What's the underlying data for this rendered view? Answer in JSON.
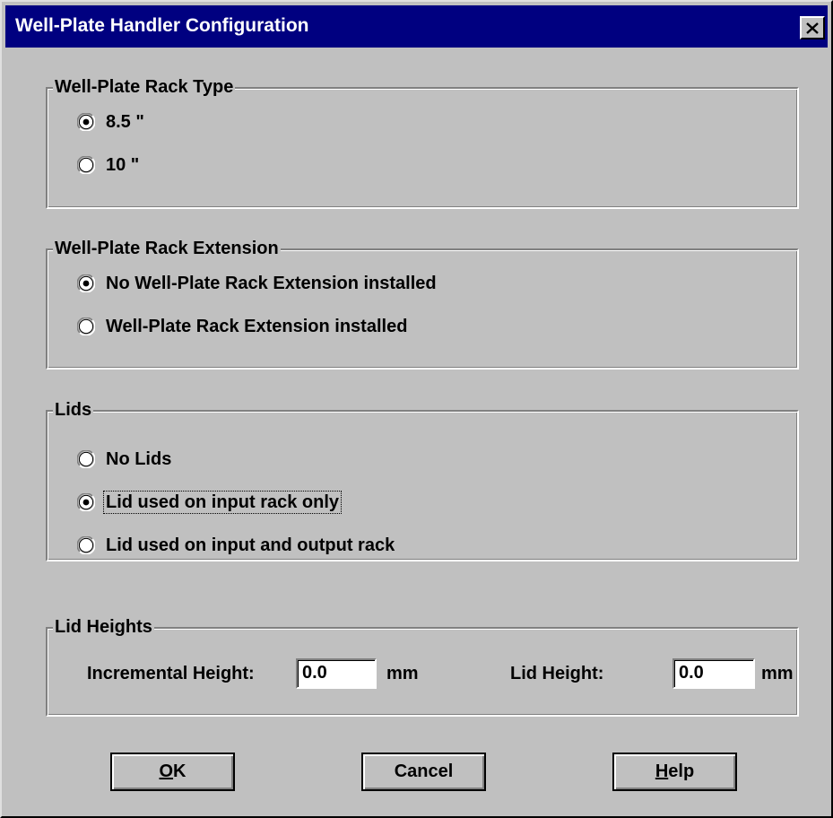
{
  "window": {
    "title": "Well-Plate Handler Configuration",
    "close_glyph": "✕"
  },
  "rack_type": {
    "label": "Well-Plate Rack Type",
    "options": [
      {
        "label": "8.5 \"",
        "selected": true
      },
      {
        "label": "10 \"",
        "selected": false
      }
    ]
  },
  "rack_extension": {
    "label": "Well-Plate Rack Extension",
    "options": [
      {
        "label": "No Well-Plate Rack Extension installed",
        "selected": true
      },
      {
        "label": "Well-Plate Rack Extension installed",
        "selected": false
      }
    ]
  },
  "lids": {
    "label": "Lids",
    "options": [
      {
        "label": "No Lids",
        "selected": false
      },
      {
        "label": "Lid used on input rack only",
        "selected": true,
        "focused": true
      },
      {
        "label": "Lid used on input and output rack",
        "selected": false
      }
    ]
  },
  "lid_heights": {
    "label": "Lid Heights",
    "incremental_label": "Incremental Height:",
    "incremental_value": "0.0",
    "incremental_unit": "mm",
    "lid_height_label": "Lid Height:",
    "lid_height_value": "0.0",
    "lid_height_unit": "mm"
  },
  "buttons": {
    "ok": {
      "mnemonic": "O",
      "rest": "K"
    },
    "cancel": {
      "label": "Cancel"
    },
    "help": {
      "mnemonic": "H",
      "rest": "elp"
    }
  },
  "colors": {
    "face": "#c0c0c0",
    "titlebar": "#000080",
    "title_text": "#ffffff"
  },
  "icons": {
    "close": "close-icon",
    "radio_on": "radio-selected-icon",
    "radio_off": "radio-unselected-icon"
  }
}
